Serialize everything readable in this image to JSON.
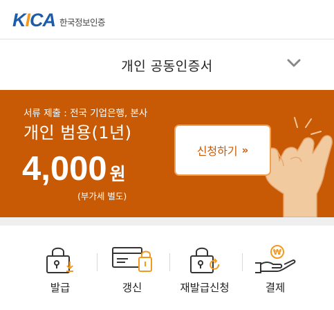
{
  "header": {
    "logo_word_k": "K",
    "logo_word_i": "I",
    "logo_word_ca": "CA",
    "logo_text": "한국정보인증"
  },
  "selector": {
    "title": "개인 공동인증서",
    "icon": "chevron-down-icon"
  },
  "banner": {
    "subtitle": "서류 제출 : 전국 기업은행, 본사",
    "title": "개인 범용(1년)",
    "price": "4,000",
    "currency": "원",
    "vat_note": "(부가세 별도)",
    "apply_label": "신청하기",
    "apply_arrow": "»",
    "background_color": "#c85a05",
    "illustration": "hand-ok-gesture"
  },
  "menu": {
    "items": [
      {
        "label": "발급",
        "icon": "lock-download-icon"
      },
      {
        "label": "갱신",
        "icon": "card-lock-icon"
      },
      {
        "label": "재발급신청",
        "icon": "lock-refresh-icon"
      },
      {
        "label": "결제",
        "icon": "hand-coin-icon"
      }
    ]
  },
  "colors": {
    "brand_blue": "#1d5ca8",
    "brand_orange": "#f39a1e",
    "accent": "#c85a05"
  }
}
